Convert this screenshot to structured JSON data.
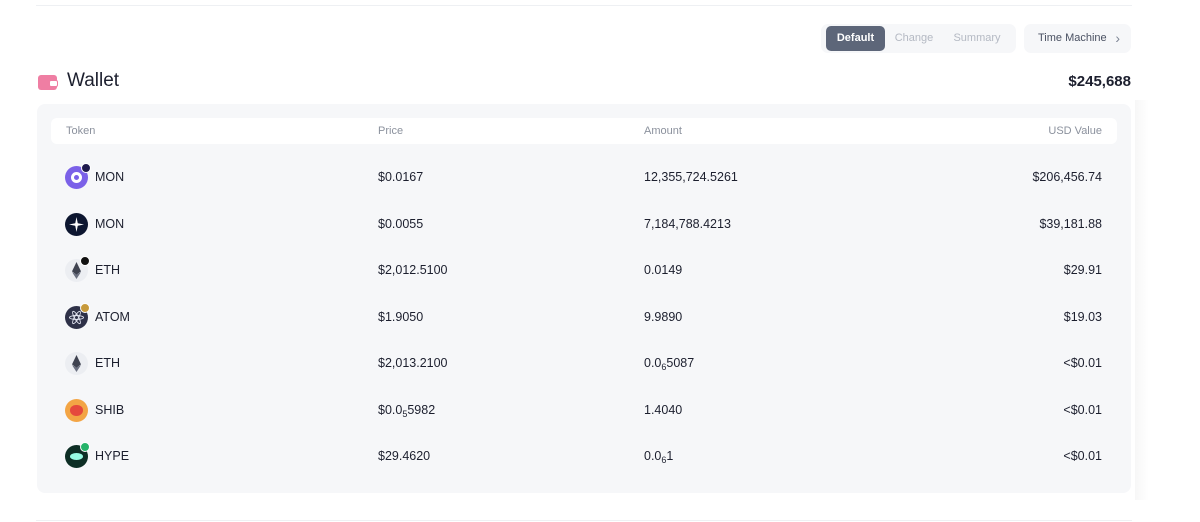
{
  "view_switch": {
    "options": [
      "Default",
      "Change",
      "Summary"
    ],
    "selected": "Default"
  },
  "time_machine": {
    "label": "Time Machine",
    "icon": "chevron-right-icon"
  },
  "wallet": {
    "icon": "wallet-icon",
    "title": "Wallet",
    "total": "$245,688"
  },
  "table": {
    "columns": [
      "Token",
      "Price",
      "Amount",
      "USD Value"
    ],
    "rows": [
      {
        "icon": "mon-icon",
        "symbol": "MON",
        "price": "$0.0167",
        "amount": "12,355,724.5261",
        "usd": "$206,456.74"
      },
      {
        "icon": "mon-icon",
        "symbol": "MON",
        "price": "$0.0055",
        "amount": "7,184,788.4213",
        "usd": "$39,181.88"
      },
      {
        "icon": "eth-icon",
        "symbol": "ETH",
        "price": "$2,012.5100",
        "amount": "0.0149",
        "usd": "$29.91"
      },
      {
        "icon": "atom-icon",
        "symbol": "ATOM",
        "price": "$1.9050",
        "amount": "9.9890",
        "usd": "$19.03"
      },
      {
        "icon": "eth-icon",
        "symbol": "ETH",
        "price": "$2,013.2100",
        "amount": {
          "prefix": "0.0",
          "zeros": "6",
          "rest": "5087"
        },
        "usd": "<$0.01"
      },
      {
        "icon": "shib-icon",
        "symbol": "SHIB",
        "price": {
          "prefix": "$0.0",
          "zeros": "5",
          "rest": "5982"
        },
        "amount": "1.4040",
        "usd": "<$0.01"
      },
      {
        "icon": "hype-icon",
        "symbol": "HYPE",
        "price": "$29.4620",
        "amount": {
          "prefix": "0.0",
          "zeros": "6",
          "rest": "1"
        },
        "usd": "<$0.01"
      }
    ]
  }
}
